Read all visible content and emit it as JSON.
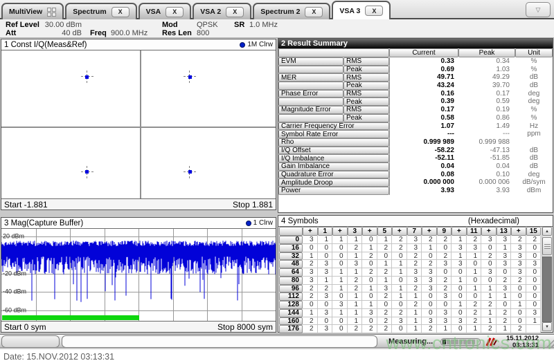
{
  "tabs": {
    "items": [
      {
        "label": "MultiView",
        "closable": false,
        "active": false,
        "icon": "grid"
      },
      {
        "label": "Spectrum",
        "closable": true,
        "active": false
      },
      {
        "label": "VSA",
        "closable": true,
        "active": false
      },
      {
        "label": "VSA 2",
        "closable": true,
        "active": false
      },
      {
        "label": "Spectrum 2",
        "closable": true,
        "active": false
      },
      {
        "label": "VSA 3",
        "closable": true,
        "active": true
      }
    ],
    "close_label": "X",
    "overflow_icon": "▽"
  },
  "settings_bar": {
    "ref_level_label": "Ref Level",
    "ref_level_value": "30.00 dBm",
    "att_label": "Att",
    "att_value": "40 dB",
    "freq_label": "Freq",
    "freq_value": "900.0 MHz",
    "mod_label": "Mod",
    "mod_value": "QPSK",
    "res_len_label": "Res Len",
    "res_len_value": "800",
    "sr_label": "SR",
    "sr_value": "1.0 MHz"
  },
  "const_window": {
    "title": "1 Const I/Q(Meas&Ref)",
    "trace_label": "1M Clrw",
    "start_label": "Start -1.881",
    "stop_label": "Stop 1.881"
  },
  "result_summary": {
    "title": "2 Result Summary",
    "columns": [
      "Current",
      "Peak",
      "Unit"
    ],
    "rows": [
      {
        "name": "EVM",
        "sub": "RMS",
        "current": "0.33",
        "peak": "0.34",
        "unit": "%"
      },
      {
        "name": "",
        "sub": "Peak",
        "current": "0.69",
        "peak": "1.03",
        "unit": "%"
      },
      {
        "name": "MER",
        "sub": "RMS",
        "current": "49.71",
        "peak": "49.29",
        "unit": "dB"
      },
      {
        "name": "",
        "sub": "Peak",
        "current": "43.24",
        "peak": "39.70",
        "unit": "dB"
      },
      {
        "name": "Phase Error",
        "sub": "RMS",
        "current": "0.16",
        "peak": "0.17",
        "unit": "deg"
      },
      {
        "name": "",
        "sub": "Peak",
        "current": "0.39",
        "peak": "0.59",
        "unit": "deg"
      },
      {
        "name": "Magnitude Error",
        "sub": "RMS",
        "current": "0.17",
        "peak": "0.19",
        "unit": "%"
      },
      {
        "name": "",
        "sub": "Peak",
        "current": "0.58",
        "peak": "0.86",
        "unit": "%"
      },
      {
        "name": "Carrier Frequency Error",
        "sub": "",
        "current": "1.07",
        "peak": "1.49",
        "unit": "Hz"
      },
      {
        "name": "Symbol Rate Error",
        "sub": "",
        "current": "---",
        "peak": "---",
        "unit": "ppm"
      },
      {
        "name": "Rho",
        "sub": "",
        "current": "0.999 989",
        "peak": "0.999 988",
        "unit": ""
      },
      {
        "name": "I/Q Offset",
        "sub": "",
        "current": "-58.22",
        "peak": "-47.13",
        "unit": "dB"
      },
      {
        "name": "I/Q Imbalance",
        "sub": "",
        "current": "-52.11",
        "peak": "-51.85",
        "unit": "dB"
      },
      {
        "name": "Gain Imbalance",
        "sub": "",
        "current": "0.04",
        "peak": "0.04",
        "unit": "dB"
      },
      {
        "name": "Quadrature Error",
        "sub": "",
        "current": "0.08",
        "peak": "0.10",
        "unit": "deg"
      },
      {
        "name": "Amplitude Droop",
        "sub": "",
        "current": "0.000 000",
        "peak": "0.000 006",
        "unit": "dB/sym"
      },
      {
        "name": "Power",
        "sub": "",
        "current": "3.93",
        "peak": "3.93",
        "unit": "dBm"
      }
    ]
  },
  "mag_window": {
    "title": "3 Mag(Capture Buffer)",
    "trace_label": "1 Clrw",
    "y_ticks": [
      "20 dBm",
      "-20 dBm",
      "-40 dBm",
      "-60 dBm"
    ],
    "start_label": "Start 0 sym",
    "stop_label": "Stop 8000 sym"
  },
  "symbols_window": {
    "title": "4 Symbols",
    "format_label": "(Hexadecimal)",
    "col_headers": [
      "+",
      "1",
      "+",
      "3",
      "+",
      "5",
      "+",
      "7",
      "+",
      "9",
      "+",
      "11",
      "+",
      "13",
      "+",
      "15"
    ],
    "rows": [
      {
        "index": "0",
        "values": [
          "3",
          "1",
          "1",
          "1",
          "0",
          "1",
          "2",
          "3",
          "2",
          "2",
          "1",
          "2",
          "3",
          "3",
          "2",
          "2"
        ]
      },
      {
        "index": "16",
        "values": [
          "0",
          "0",
          "0",
          "2",
          "1",
          "2",
          "2",
          "3",
          "1",
          "0",
          "3",
          "3",
          "0",
          "1",
          "3",
          "0"
        ]
      },
      {
        "index": "32",
        "values": [
          "1",
          "0",
          "0",
          "1",
          "2",
          "0",
          "0",
          "2",
          "0",
          "2",
          "1",
          "1",
          "2",
          "3",
          "3",
          "0"
        ]
      },
      {
        "index": "48",
        "values": [
          "2",
          "3",
          "0",
          "3",
          "0",
          "1",
          "1",
          "2",
          "2",
          "3",
          "3",
          "0",
          "0",
          "3",
          "3",
          "3"
        ]
      },
      {
        "index": "64",
        "values": [
          "3",
          "3",
          "1",
          "1",
          "2",
          "2",
          "1",
          "3",
          "3",
          "0",
          "0",
          "1",
          "3",
          "0",
          "3",
          "0"
        ]
      },
      {
        "index": "80",
        "values": [
          "3",
          "1",
          "1",
          "2",
          "0",
          "1",
          "0",
          "3",
          "3",
          "2",
          "1",
          "0",
          "0",
          "2",
          "2",
          "0"
        ]
      },
      {
        "index": "96",
        "values": [
          "2",
          "2",
          "1",
          "2",
          "1",
          "3",
          "1",
          "2",
          "3",
          "2",
          "0",
          "1",
          "1",
          "3",
          "0",
          "0"
        ]
      },
      {
        "index": "112",
        "values": [
          "2",
          "3",
          "0",
          "1",
          "0",
          "2",
          "1",
          "1",
          "0",
          "3",
          "0",
          "0",
          "1",
          "1",
          "0",
          "0"
        ]
      },
      {
        "index": "128",
        "values": [
          "0",
          "0",
          "3",
          "1",
          "1",
          "0",
          "0",
          "2",
          "0",
          "0",
          "1",
          "2",
          "2",
          "0",
          "1",
          "0"
        ]
      },
      {
        "index": "144",
        "values": [
          "1",
          "3",
          "1",
          "1",
          "3",
          "2",
          "2",
          "1",
          "0",
          "3",
          "0",
          "2",
          "1",
          "2",
          "0",
          "3"
        ]
      },
      {
        "index": "160",
        "values": [
          "2",
          "0",
          "0",
          "1",
          "0",
          "2",
          "3",
          "1",
          "3",
          "3",
          "3",
          "2",
          "1",
          "2",
          "0",
          "1"
        ]
      },
      {
        "index": "176",
        "values": [
          "2",
          "3",
          "0",
          "2",
          "2",
          "2",
          "0",
          "1",
          "2",
          "1",
          "0",
          "1",
          "2",
          "1",
          "2",
          ""
        ]
      }
    ]
  },
  "status_bar": {
    "measuring_label": "Measuring...",
    "date": "15.11.2012",
    "time": "03:13:31"
  },
  "footer": {
    "date_label": "Date: 15.NOV.2012  03:13:31",
    "watermark": "www.cntronics.com"
  },
  "icons": {
    "scroll_up": "▲",
    "scroll_down": "▼"
  },
  "colors": {
    "trace_blue": "#0202d8",
    "marker_blue": "#0008e0",
    "analyzed_green": "#0ed60e",
    "title_bar_dark": "#050505",
    "alert_red": "#cc0000"
  },
  "chart_data": [
    {
      "type": "scatter",
      "title": "Const I/Q(Meas&Ref)",
      "x_range": [
        -1.881,
        1.881
      ],
      "y_range": [
        -1.1,
        1.1
      ],
      "points": [
        [
          -0.707,
          0.707
        ],
        [
          0.707,
          0.707
        ],
        [
          -0.707,
          -0.707
        ],
        [
          0.707,
          -0.707
        ]
      ],
      "marker": "blue-square-with-dashed-crosshair",
      "grid": "center-cross"
    },
    {
      "type": "line",
      "title": "Mag(Capture Buffer)",
      "x_range_sym": [
        0,
        8000
      ],
      "ylim_dbm": [
        -68,
        28
      ],
      "y_ticks_dbm": [
        20,
        -20,
        -40,
        -60
      ],
      "signal_mean_dbm": 0,
      "signal_spike_min_dbm": -30,
      "analyzed_fraction_green_bar": 0.5,
      "grid": true,
      "legend": "1 Clrw"
    }
  ]
}
